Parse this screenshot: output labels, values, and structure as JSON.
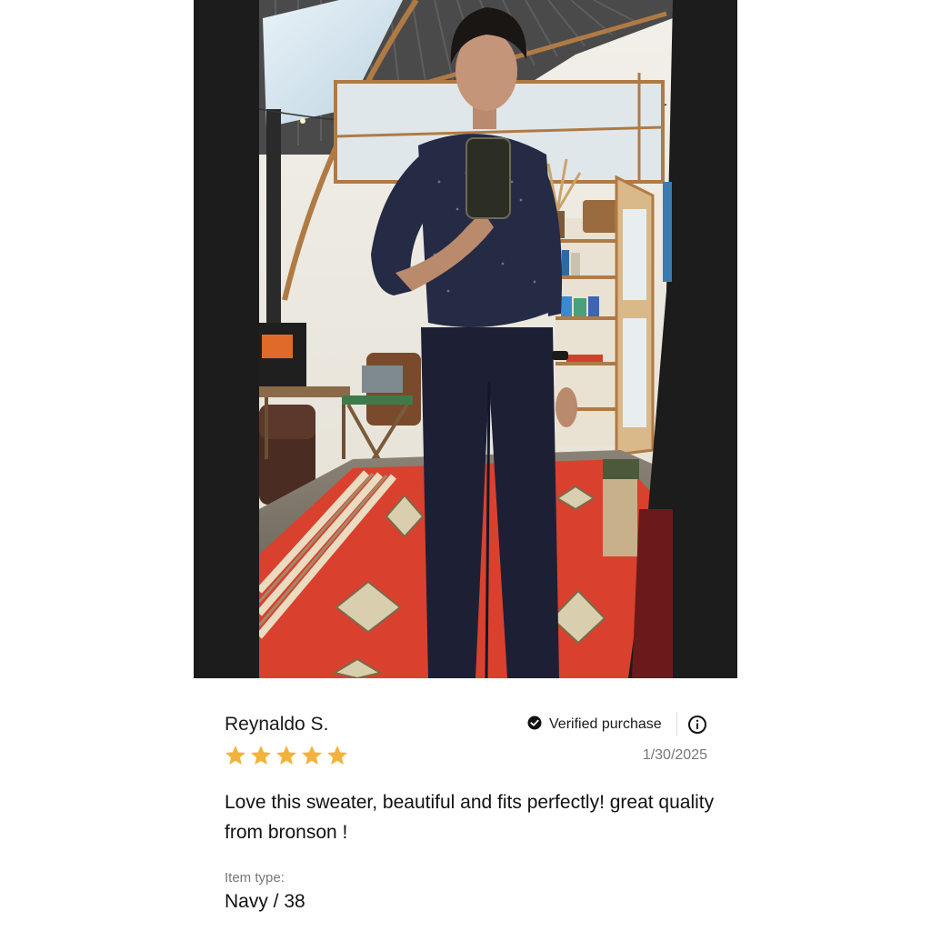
{
  "photo": {
    "alt": "Review photo"
  },
  "review": {
    "reviewer_name": "Reynaldo S.",
    "verified_label": "Verified purchase",
    "rating": 5,
    "rating_max": 5,
    "date": "1/30/2025",
    "body": "Love this sweater, beautiful and fits perfectly! great quality from bronson !",
    "item_type_label": "Item type:",
    "item_type_value": "Navy / 38"
  },
  "icons": {
    "verified": "check-circle-icon",
    "info": "info-icon",
    "star": "star-icon"
  },
  "colors": {
    "star": "#F2B33D",
    "text_primary": "#111111",
    "text_muted": "#777777",
    "rug_red": "#D9412E",
    "sweater_navy": "#1F2440"
  }
}
